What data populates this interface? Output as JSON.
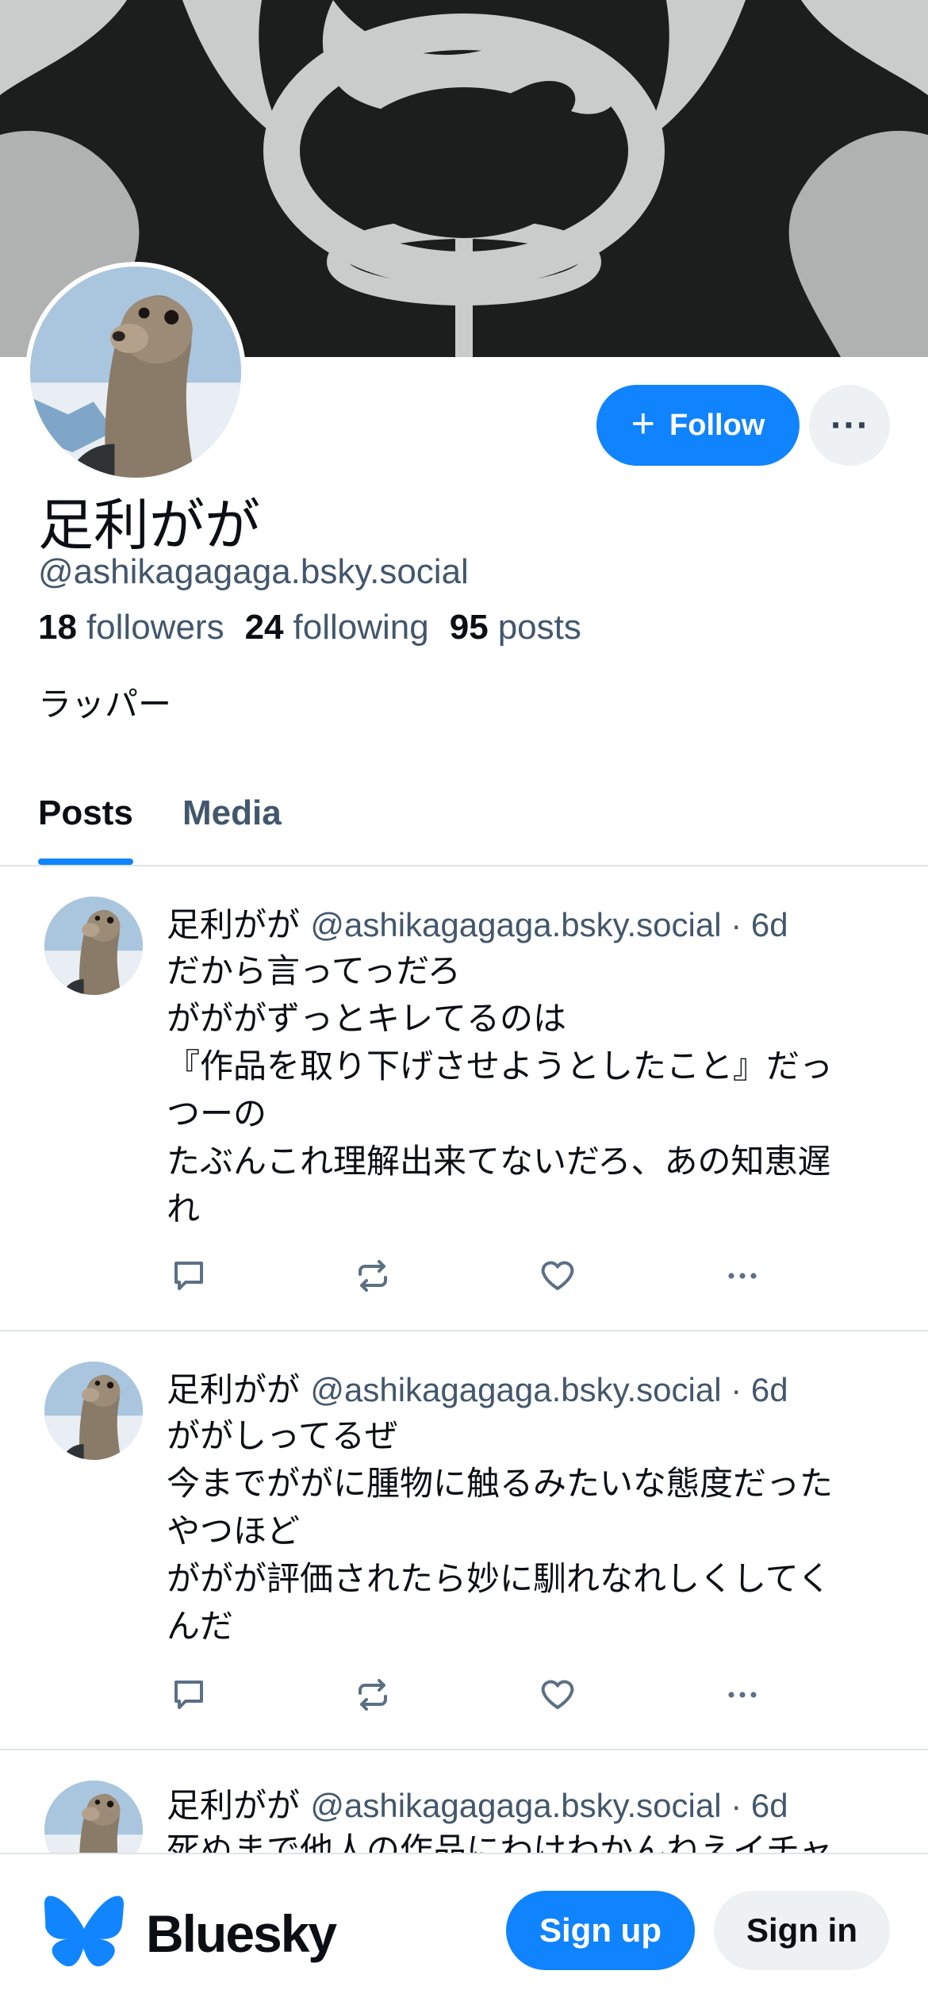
{
  "profile": {
    "display_name": "足利がが",
    "handle": "@ashikagagaga.bsky.social",
    "followers_count": "18",
    "followers_label": "followers",
    "following_count": "24",
    "following_label": "following",
    "posts_count": "95",
    "posts_label": "posts",
    "bio": "ラッパー"
  },
  "actions": {
    "follow_label": "Follow",
    "follow_icon": "plus-icon",
    "more_icon": "ellipsis-icon"
  },
  "tabs": [
    {
      "label": "Posts",
      "active": true
    },
    {
      "label": "Media",
      "active": false
    }
  ],
  "posts": [
    {
      "author": "足利がが",
      "handle_time": "@ashikagagaga.bsky.social · 6d",
      "text": "だから言ってっだろ\nがががずっとキレてるのは\n『作品を取り下げさせようとしたこと』だっ\nつーの\nたぶんこれ理解出来てないだろ、あの知恵遅\nれ"
    },
    {
      "author": "足利がが",
      "handle_time": "@ashikagagaga.bsky.social · 6d",
      "text": "ががしってるぜ\n今までががに腫物に触るみたいな態度だった\nやつほど\nががが評価されたら妙に馴れなれしくしてく\nんだ"
    },
    {
      "author": "足利がが",
      "handle_time": "@ashikagagaga.bsky.social · 6d",
      "text": "死ぬまで他人の作品にわけわかんねえイチャ"
    }
  ],
  "post_action_icons": [
    "reply-icon",
    "repost-icon",
    "like-icon",
    "more-icon"
  ],
  "footer": {
    "brand": "Bluesky",
    "signup_label": "Sign up",
    "signin_label": "Sign in"
  },
  "colors": {
    "accent": "#1083fe",
    "text_primary": "#0b0f14",
    "text_secondary": "#42576c",
    "divider": "#dfe4e8"
  }
}
